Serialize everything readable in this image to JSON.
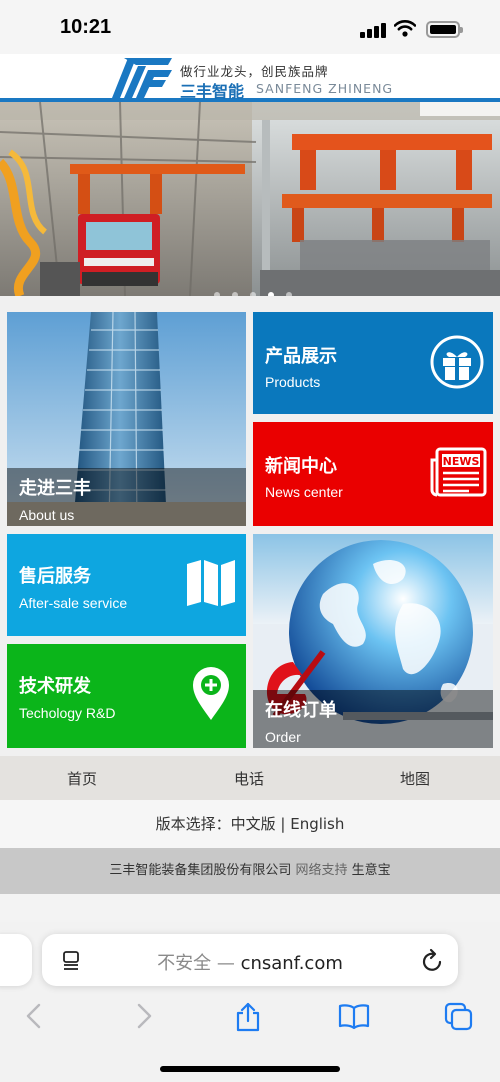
{
  "status_bar": {
    "time": "10:21"
  },
  "header": {
    "slogan": "做行业龙头，创民族品牌",
    "brand_cn": "三丰智能",
    "brand_en": "SANFENG ZHINENG"
  },
  "banner": {
    "slide_count": 5,
    "active_slide": 3
  },
  "tiles": {
    "about": {
      "cn": "走进三丰",
      "en": "About us"
    },
    "products": {
      "cn": "产品展示",
      "en": "Products",
      "color": "#0a78bd"
    },
    "news": {
      "cn": "新闻中心",
      "en": "News center",
      "color": "#ea0000",
      "icon_text": "NEWS"
    },
    "aftersale": {
      "cn": "售后服务",
      "en": "After-sale service",
      "color": "#0ea6e0"
    },
    "rd": {
      "cn": "技术研发",
      "en": "Techology R&D",
      "color": "#0bb51a"
    },
    "order": {
      "cn": "在线订单",
      "en": "Order"
    }
  },
  "nav": {
    "home": "首页",
    "phone": "电话",
    "map": "地图"
  },
  "language": {
    "label": "版本选择：",
    "chinese": "中文版",
    "separator": " | ",
    "english": "English"
  },
  "footer": {
    "company": "三丰智能装备集团股份有限公司",
    "support": "网络支持",
    "provider": "生意宝"
  },
  "browser": {
    "not_secure": "不安全 — ",
    "domain": "cnsanf.com"
  },
  "colors": {
    "brand_blue": "#1a78c2"
  }
}
